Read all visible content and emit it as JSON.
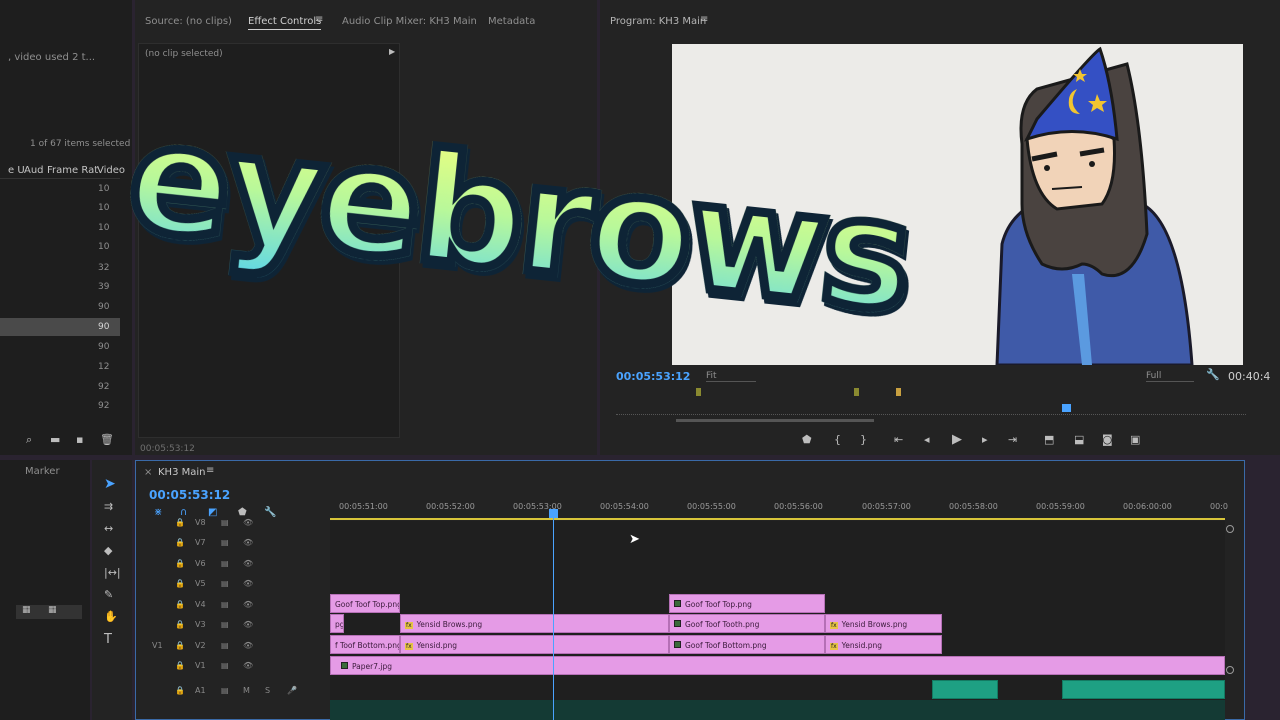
{
  "project": {
    "search_text": ", video used 2 t...",
    "items_selected": "1 of 67 items selected",
    "columns": [
      "e U",
      "Aud",
      "Frame Rat",
      "Video"
    ],
    "rows": [
      "10",
      "10",
      "10",
      "10",
      "32",
      "39",
      "90",
      "90",
      "90",
      "12",
      "92",
      "92"
    ]
  },
  "source_tabs": {
    "source": "Source: (no clips)",
    "effect_controls": "Effect Controls",
    "audio_mixer": "Audio Clip Mixer: KH3 Main",
    "metadata": "Metadata"
  },
  "effect_controls": {
    "no_clip": "(no clip selected)",
    "timecode": "00:05:53:12"
  },
  "program": {
    "title": "Program: KH3 Main",
    "timecode": "00:05:53:12",
    "fit": "Fit",
    "quality": "Full",
    "duration": "00:40:4"
  },
  "left_panel": {
    "marker_tab": "Marker"
  },
  "timeline": {
    "tab": "KH3 Main",
    "timecode": "00:05:53:12",
    "ruler": [
      "00:05:51:00",
      "00:05:52:00",
      "00:05:53:00",
      "00:05:54:00",
      "00:05:55:00",
      "00:05:56:00",
      "00:05:57:00",
      "00:05:58:00",
      "00:05:59:00",
      "00:06:00:00",
      "00:0"
    ],
    "tracks": [
      "V8",
      "V7",
      "V6",
      "V5",
      "V4",
      "V3",
      "V2",
      "V1",
      "A1"
    ],
    "source_patch": "V1",
    "audio_m": "M",
    "audio_s": "S",
    "clips": {
      "c1": "Goof Toof Top.png",
      "c2": "pg",
      "c3": "Yensid Brows.png",
      "c4": "f Toof Bottom.png",
      "c5": "Yensid.png",
      "c6": "Goof Toof Top.png",
      "c7": "Goof Toof Tooth.png",
      "c8": "Yensid Brows.png",
      "c9": "Goof Toof Bottom.png",
      "c10": "Yensid.png",
      "c11": "Paper7.jpg"
    }
  },
  "overlay": {
    "title": "eyebrows"
  }
}
